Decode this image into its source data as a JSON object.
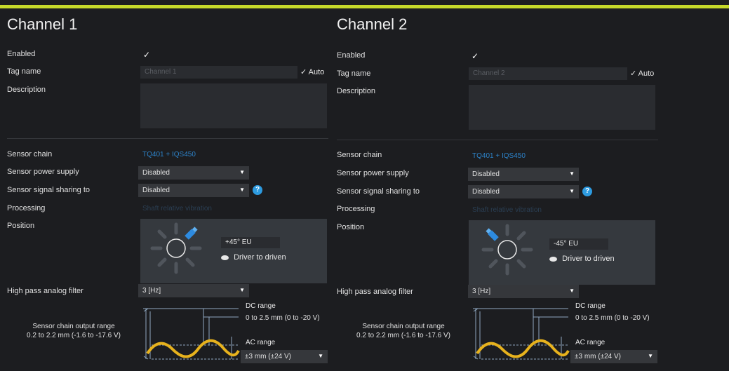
{
  "colors": {
    "accent_bar": "#c5d82a",
    "link": "#2d83c9",
    "sensor_icon": "#2d8be0",
    "wave": "#e7b21d"
  },
  "channels": [
    {
      "title": "Channel 1",
      "labels": {
        "enabled": "Enabled",
        "tag_name": "Tag name",
        "description": "Description",
        "sensor_chain": "Sensor chain",
        "power_supply": "Sensor power supply",
        "signal_sharing": "Sensor signal sharing to",
        "processing": "Processing",
        "position": "Position",
        "hp_filter": "High pass analog filter"
      },
      "enabled_checked": "✓",
      "tag_placeholder": "Channel 1",
      "tag_auto_label": "Auto",
      "tag_auto_check": "✓",
      "description_value": "",
      "sensor_chain_value": "TQ401 + IQS450",
      "power_supply_value": "Disabled",
      "signal_sharing_value": "Disabled",
      "help_glyph": "?",
      "processing_value": "Shaft relative vibration",
      "position_value": "+45° EU",
      "direction_label": "Driver to driven",
      "hp_filter_value": "3 [Hz]",
      "output_range_title": "Sensor chain output range",
      "output_range_value": "0.2 to 2.2 mm (-1.6 to -17.6 V)",
      "dc_range_label": "DC range",
      "dc_range_value": "0 to 2.5 mm (0 to -20 V)",
      "ac_range_label": "AC range",
      "ac_range_value": "±3 mm (±24 V)"
    },
    {
      "title": "Channel 2",
      "labels": {
        "enabled": "Enabled",
        "tag_name": "Tag name",
        "description": "Description",
        "sensor_chain": "Sensor chain",
        "power_supply": "Sensor power supply",
        "signal_sharing": "Sensor signal sharing to",
        "processing": "Processing",
        "position": "Position",
        "hp_filter": "High pass analog filter"
      },
      "enabled_checked": "✓",
      "tag_placeholder": "Channel 2",
      "tag_auto_label": "Auto",
      "tag_auto_check": "✓",
      "description_value": "",
      "sensor_chain_value": "TQ401 + IQS450",
      "power_supply_value": "Disabled",
      "signal_sharing_value": "Disabled",
      "help_glyph": "?",
      "processing_value": "Shaft relative vibration",
      "position_value": "-45° EU",
      "direction_label": "Driver to driven",
      "hp_filter_value": "3 [Hz]",
      "output_range_title": "Sensor chain output range",
      "output_range_value": "0.2 to 2.2 mm (-1.6 to -17.6 V)",
      "dc_range_label": "DC range",
      "dc_range_value": "0 to 2.5 mm (0 to -20 V)",
      "ac_range_label": "AC range",
      "ac_range_value": "±3 mm (±24 V)"
    }
  ]
}
